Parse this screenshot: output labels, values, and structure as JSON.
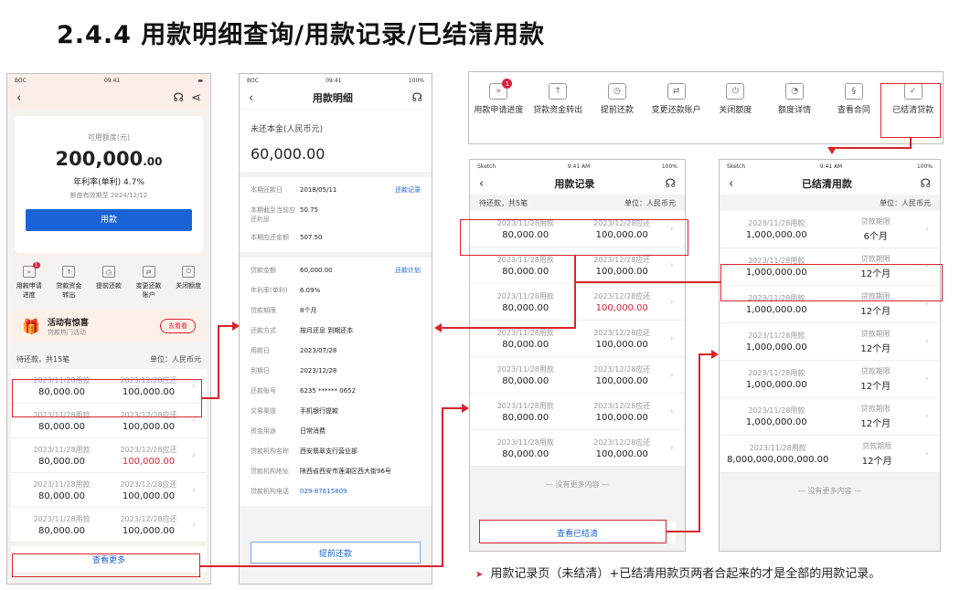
{
  "page_title": "2.4.4 用款明细查询/用款记录/已结清用款",
  "p1": {
    "status_l": "BOC",
    "status_t": "09:41",
    "credit_label": "可用额度(元)",
    "credit_amt": "200,000",
    "credit_dec": ".00",
    "rate": "年利率(单利) 4.7%",
    "valid": "额度有效期至 2024/12/12",
    "use_btn": "用款",
    "icons": [
      {
        "label": "用款申请进度",
        "badge": "1"
      },
      {
        "label": "贷款资金转出"
      },
      {
        "label": "提前还款"
      },
      {
        "label": "变更还款账户"
      },
      {
        "label": "关闭额度"
      }
    ],
    "promo_title": "活动有惊喜",
    "promo_sub": "贷款热门活动",
    "promo_btn": "去看看",
    "hdr_l": "待还款，共15笔",
    "hdr_r": "单位：人民币元",
    "rows": [
      {
        "d1": "2023/11/28用款",
        "a1": "80,000.00",
        "d2": "2023/12/28应还",
        "a2": "100,000.00"
      },
      {
        "d1": "2023/11/28用款",
        "a1": "80,000.00",
        "d2": "2023/12/28应还",
        "a2": "100,000.00"
      },
      {
        "d1": "2023/11/28用款",
        "a1": "80,000.00",
        "d2": "2023/12/28应还",
        "a2": "100,000.00",
        "red": true
      },
      {
        "d1": "2023/11/28用款",
        "a1": "80,000.00",
        "d2": "2023/12/28应还",
        "a2": "100,000.00"
      },
      {
        "d1": "2023/11/28用款",
        "a1": "80,000.00",
        "d2": "2023/12/28应还",
        "a2": "100,000.00"
      }
    ],
    "more_btn": "查看更多"
  },
  "p2": {
    "status_l": "BOC",
    "status_t": "09:41",
    "status_r": "100%",
    "title": "用款明细",
    "unpaid_label": "未还本金(人民币元)",
    "unpaid_amt": "60,000.00",
    "g1": [
      {
        "k": "本期还款日",
        "v": "2018/05/11",
        "link": "还款记录"
      },
      {
        "k": "本期截至当前应还利息",
        "v": "50.75"
      },
      {
        "k": "本期应还金额",
        "v": "507.50"
      }
    ],
    "g2": [
      {
        "k": "贷款金额",
        "v": "60,000.00",
        "link": "还款计划"
      },
      {
        "k": "年利率(单利)",
        "v": "6.09%"
      },
      {
        "k": "贷款期限",
        "v": "8个月"
      },
      {
        "k": "还款方式",
        "v": "按月还息 到期还本"
      },
      {
        "k": "用款日",
        "v": "2023/07/28"
      },
      {
        "k": "到期日",
        "v": "2023/12/28"
      },
      {
        "k": "还款账号",
        "v": "6235 ****** 0652"
      },
      {
        "k": "交易渠道",
        "v": "手机银行提款"
      },
      {
        "k": "资金用途",
        "v": "日常消费"
      },
      {
        "k": "贷款机构名称",
        "v": "西安翡翠支行营业部"
      },
      {
        "k": "贷款机构地址",
        "v": "陕西省西安市莲湖区西大街96号"
      },
      {
        "k": "贷款机构电话",
        "v": "029-87615809",
        "blue": true
      }
    ],
    "btn": "提前还款"
  },
  "toolbar": [
    {
      "label": "用款申请进度",
      "badge": "1",
      "g": "»"
    },
    {
      "label": "贷款资金转出",
      "g": "↑"
    },
    {
      "label": "提前还款",
      "g": "◷"
    },
    {
      "label": "变更还款账户",
      "g": "⇄"
    },
    {
      "label": "关闭额度",
      "g": "⏻"
    },
    {
      "label": "额度详情",
      "g": "◔"
    },
    {
      "label": "查看合同",
      "g": "§"
    },
    {
      "label": "已结清贷款",
      "g": "✓"
    }
  ],
  "p3": {
    "status_l": "Sketch",
    "status_t": "9:41 AM",
    "status_r": "100%",
    "title": "用款记录",
    "hdr_l": "待还款，共5笔",
    "hdr_r": "单位：人民币元",
    "rows": [
      {
        "d1": "2023/11/28用款",
        "a1": "80,000.00",
        "d2": "2023/12/28应还",
        "a2": "100,000.00"
      },
      {
        "d1": "2023/11/28用款",
        "a1": "80,000.00",
        "d2": "2023/12/28应还",
        "a2": "100,000.00"
      },
      {
        "d1": "2023/11/28用款",
        "a1": "80,000.00",
        "d2": "2023/12/28应还",
        "a2": "100,000.00",
        "red": true
      },
      {
        "d1": "2023/11/28用款",
        "a1": "80,000.00",
        "d2": "2023/12/28应还",
        "a2": "100,000.00"
      },
      {
        "d1": "2023/11/28用款",
        "a1": "80,000.00",
        "d2": "2023/12/28应还",
        "a2": "100,000.00"
      },
      {
        "d1": "2023/11/28用款",
        "a1": "80,000.00",
        "d2": "2023/12/28应还",
        "a2": "100,000.00"
      },
      {
        "d1": "2023/11/28用款",
        "a1": "80,000.00",
        "d2": "2023/12/28应还",
        "a2": "100,000.00"
      }
    ],
    "no_more": "— 没有更多内容 —",
    "btn": "查看已结清"
  },
  "p4": {
    "status_l": "Sketch",
    "status_t": "9:41 AM",
    "status_r": "100%",
    "title": "已结清用款",
    "hdr_r": "单位：人民币元",
    "rows": [
      {
        "d1": "2023/11/28用款",
        "a1": "1,000,000.00",
        "d2": "贷款期限",
        "a2": "6个月"
      },
      {
        "d1": "2023/11/28用款",
        "a1": "1,000,000.00",
        "d2": "贷款期限",
        "a2": "12个月"
      },
      {
        "d1": "2023/11/28用款",
        "a1": "1,000,000.00",
        "d2": "贷款期限",
        "a2": "12个月"
      },
      {
        "d1": "2023/11/28用款",
        "a1": "1,000,000.00",
        "d2": "贷款期限",
        "a2": "12个月"
      },
      {
        "d1": "2023/11/28用款",
        "a1": "1,000,000.00",
        "d2": "贷款期限",
        "a2": "12个月"
      },
      {
        "d1": "2023/11/28用款",
        "a1": "1,000,000.00",
        "d2": "贷款期限",
        "a2": "12个月"
      },
      {
        "d1": "2023/11/28用款",
        "a1": "8,000,000,000,000.00",
        "d2": "贷款期限",
        "a2": "12个月"
      }
    ],
    "no_more": "— 没有更多内容 —"
  },
  "note": "用款记录页（未结清）+已结清用款页两者合起来的才是全部的用款记录。"
}
